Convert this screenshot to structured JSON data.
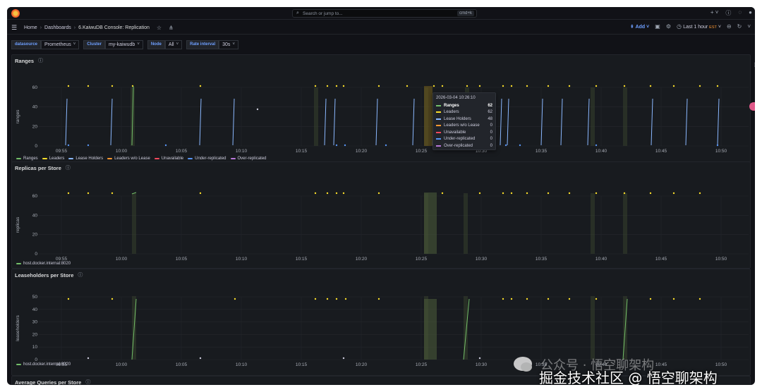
{
  "topbar": {
    "search_placeholder": "Search or jump to...",
    "search_shortcut": "cmd+k",
    "icons": [
      "plus-icon",
      "help-icon",
      "rss-icon",
      "avatar"
    ]
  },
  "breadcrumb": {
    "home": "Home",
    "dashboards": "Dashboards",
    "current": "6.KaiwuDB Console: Replication"
  },
  "toolbar": {
    "add_label": "Add",
    "time_range": "Last 1 hour",
    "timezone": "EST"
  },
  "variables": [
    {
      "label": "datasource",
      "value": "Prometheus"
    },
    {
      "label": "Cluster",
      "value": "my-kaiwudb"
    },
    {
      "label": "Node",
      "value": "All"
    },
    {
      "label": "Rate interval",
      "value": "30s"
    }
  ],
  "x_ticks": [
    "09:55",
    "10:00",
    "10:05",
    "10:10",
    "10:15",
    "10:20",
    "10:25",
    "10:30",
    "10:35",
    "10:40",
    "10:45",
    "10:50"
  ],
  "panels": {
    "ranges": {
      "title": "Ranges",
      "ylabel": "ranges",
      "yticks": [
        "0",
        "20",
        "40",
        "60"
      ],
      "legend": [
        {
          "name": "Ranges",
          "color": "#73bf69"
        },
        {
          "name": "Leaders",
          "color": "#fade2a"
        },
        {
          "name": "Lease Holders",
          "color": "#8ab8ff"
        },
        {
          "name": "Leaders w/o Lease",
          "color": "#ff9830"
        },
        {
          "name": "Unavailable",
          "color": "#f2495c"
        },
        {
          "name": "Under-replicated",
          "color": "#5794f2"
        },
        {
          "name": "Over-replicated",
          "color": "#b877d9"
        }
      ]
    },
    "replicas": {
      "title": "Replicas per Store",
      "ylabel": "replicas",
      "yticks": [
        "0",
        "20",
        "40",
        "60"
      ],
      "legend": [
        {
          "name": "host.docker.internal:8020",
          "color": "#73bf69"
        }
      ]
    },
    "leaseholders": {
      "title": "Leaseholders per Store",
      "ylabel": "leaseholders",
      "yticks": [
        "0",
        "10",
        "20",
        "30",
        "40",
        "50"
      ],
      "legend": [
        {
          "name": "host.docker.internal:8020",
          "color": "#73bf69"
        }
      ]
    },
    "queries": {
      "title": "Average Queries per Store"
    }
  },
  "tooltip": {
    "time": "2026-03-04 10:26:10",
    "rows": [
      {
        "name": "Ranges",
        "value": "62",
        "color": "#73bf69",
        "bold": true
      },
      {
        "name": "Leaders",
        "value": "62",
        "color": "#fade2a",
        "bold": false
      },
      {
        "name": "Lease Holders",
        "value": "48",
        "color": "#8ab8ff",
        "bold": false
      },
      {
        "name": "Leaders w/o Lease",
        "value": "0",
        "color": "#ff9830",
        "bold": false
      },
      {
        "name": "Unavailable",
        "value": "0",
        "color": "#f2495c",
        "bold": false
      },
      {
        "name": "Under-replicated",
        "value": "0",
        "color": "#5794f2",
        "bold": false
      },
      {
        "name": "Over-replicated",
        "value": "0",
        "color": "#b877d9",
        "bold": false
      }
    ]
  },
  "watermark": {
    "line1": "公众号 · 悟空聊架构",
    "line2": "掘金技术社区 @ 悟空聊架构"
  }
}
